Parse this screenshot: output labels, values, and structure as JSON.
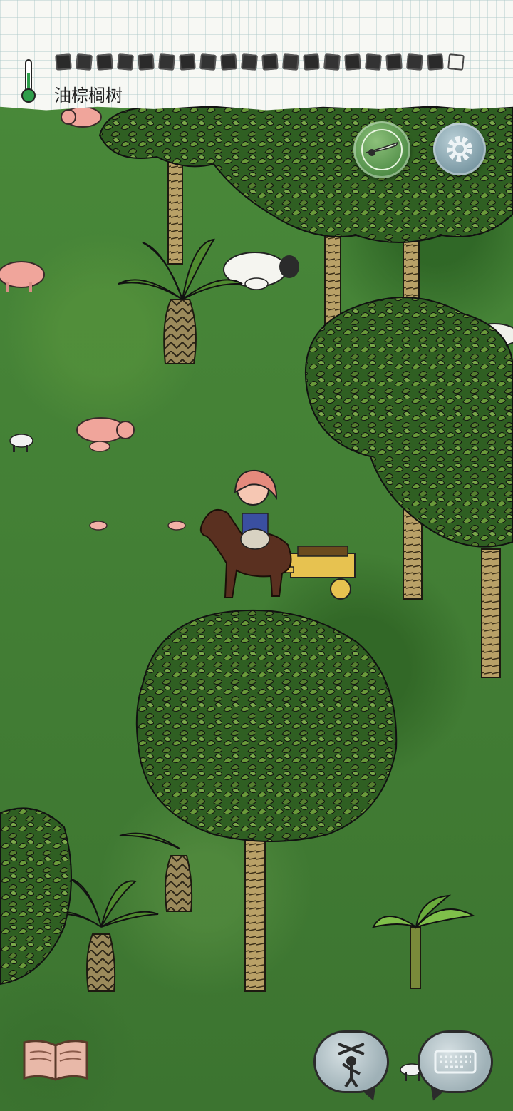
{
  "hud": {
    "object_name": "油棕榈树",
    "food_pips_filled": 19,
    "food_pips_total": 20
  },
  "icons": {
    "temperature": "thermometer-icon",
    "compass": "compass-icon",
    "settings": "gear-icon",
    "book": "book-icon",
    "emote": "puppet-icon",
    "keyboard": "keyboard-icon"
  },
  "colors": {
    "grass": "#3f7a30",
    "thermometer": "#2e9e4a",
    "paper": "#f7f8f4"
  }
}
